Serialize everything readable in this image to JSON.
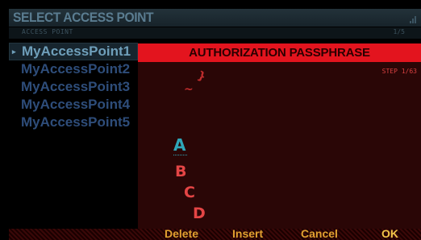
{
  "header": {
    "title": "SELECT ACCESS POINT",
    "signal_icon": "signal-bars-icon"
  },
  "subheader": {
    "label": "ACCESS POINT",
    "count": "1/5"
  },
  "access_points": [
    {
      "name": "MyAccessPoint1",
      "selected": true
    },
    {
      "name": "MyAccessPoint2"
    },
    {
      "name": "MyAccessPoint3"
    },
    {
      "name": "MyAccessPoint4"
    },
    {
      "name": "MyAccessPoint5"
    }
  ],
  "dialog": {
    "title": "AUTHORIZATION PASSPHRASE",
    "step": "STEP 1/63",
    "chars_above": [
      "}",
      "~"
    ],
    "current_char": "A",
    "chars_below": [
      "B",
      "C",
      "D"
    ]
  },
  "function_keys": {
    "delete": "Delete",
    "insert": "Insert",
    "cancel": "Cancel",
    "ok": "OK"
  },
  "colors": {
    "header_red": "#e3141e",
    "list_blue": "#2e4d7a",
    "selected_blue": "#6f9fba",
    "cursor_cyan": "#2fa6b8",
    "key_orange": "#e0a030"
  }
}
